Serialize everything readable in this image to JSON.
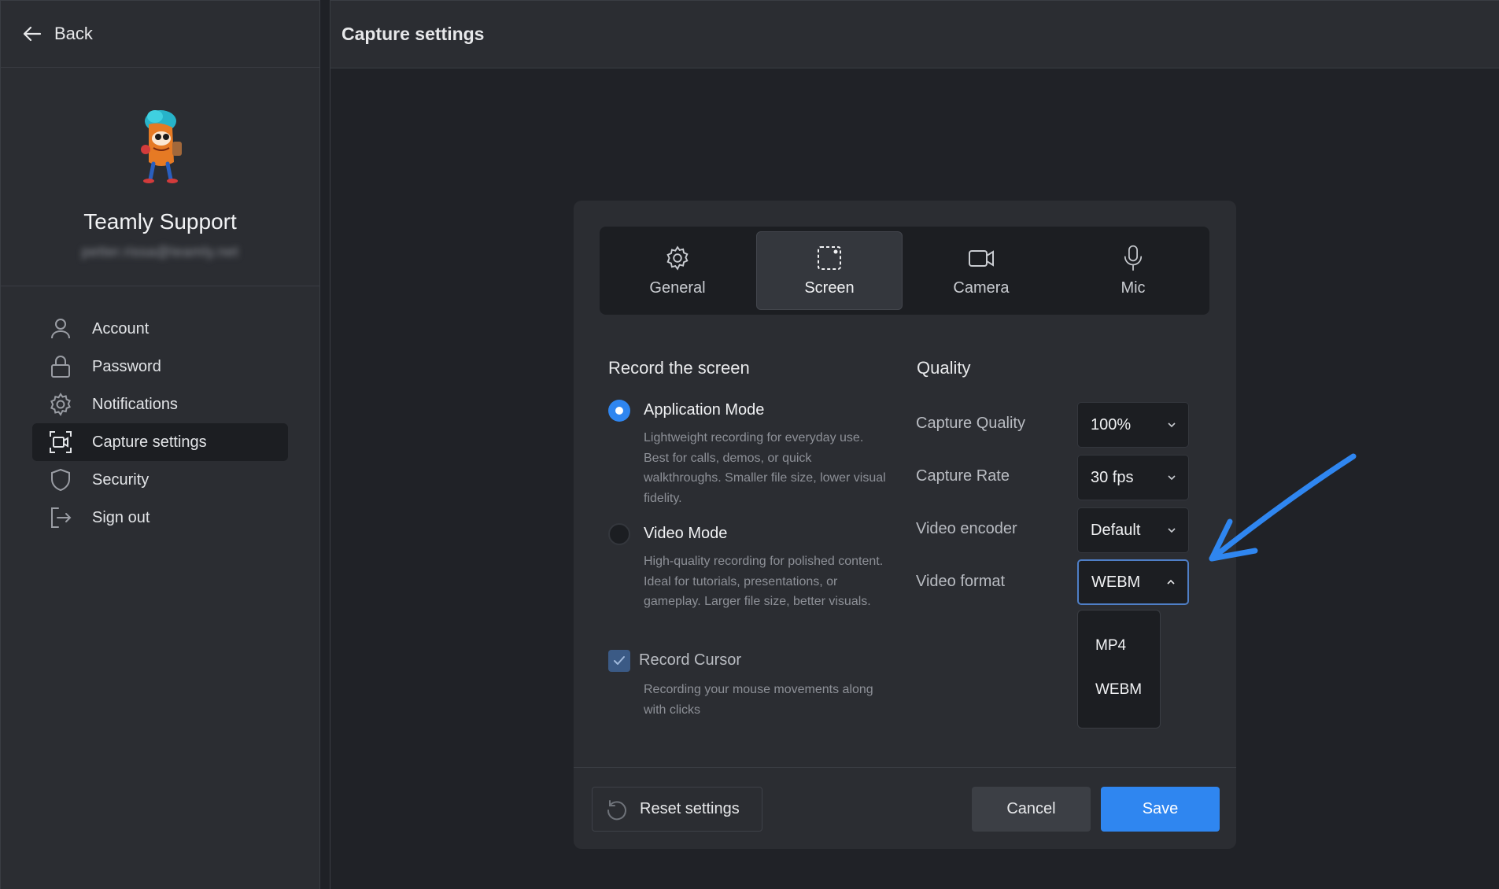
{
  "sidebar": {
    "back_label": "Back",
    "profile": {
      "name": "Teamly Support",
      "email": "petter.rissa@teamly.net"
    },
    "items": [
      {
        "label": "Account",
        "icon": "user-icon"
      },
      {
        "label": "Password",
        "icon": "lock-icon"
      },
      {
        "label": "Notifications",
        "icon": "gear-icon"
      },
      {
        "label": "Capture settings",
        "icon": "capture-icon",
        "active": true
      },
      {
        "label": "Security",
        "icon": "shield-icon"
      },
      {
        "label": "Sign out",
        "icon": "sign-out-icon"
      }
    ]
  },
  "main": {
    "title": "Capture settings"
  },
  "dialog": {
    "tabs": [
      {
        "label": "General",
        "icon": "gear-icon"
      },
      {
        "label": "Screen",
        "icon": "screen-capture-icon",
        "active": true
      },
      {
        "label": "Camera",
        "icon": "camera-icon"
      },
      {
        "label": "Mic",
        "icon": "microphone-icon"
      }
    ],
    "record": {
      "title": "Record the screen",
      "app_mode": {
        "title": "Application Mode",
        "desc": "Lightweight recording for everyday use. Best for calls, demos, or quick walkthroughs. Smaller file size, lower visual fidelity.",
        "selected": true
      },
      "video_mode": {
        "title": "Video Mode",
        "desc": "High-quality recording for polished content. Ideal for tutorials, presentations, or gameplay. Larger file size, better visuals.",
        "selected": false
      },
      "cursor": {
        "title": "Record Cursor",
        "desc": "Recording your mouse movements along with clicks",
        "checked": true
      }
    },
    "quality": {
      "title": "Quality",
      "capture_quality": {
        "label": "Capture Quality",
        "value": "100%"
      },
      "capture_rate": {
        "label": "Capture Rate",
        "value": "30 fps"
      },
      "video_encoder": {
        "label": "Video encoder",
        "value": "Default"
      },
      "video_format": {
        "label": "Video format",
        "value": "WEBM",
        "options": [
          "MP4",
          "WEBM"
        ]
      }
    },
    "buttons": {
      "reset": "Reset settings",
      "cancel": "Cancel",
      "save": "Save"
    }
  },
  "colors": {
    "accent": "#2f86f0",
    "annotation_arrow": "#2f86f0",
    "background": "#1f2126",
    "panel": "#2b2d32"
  }
}
